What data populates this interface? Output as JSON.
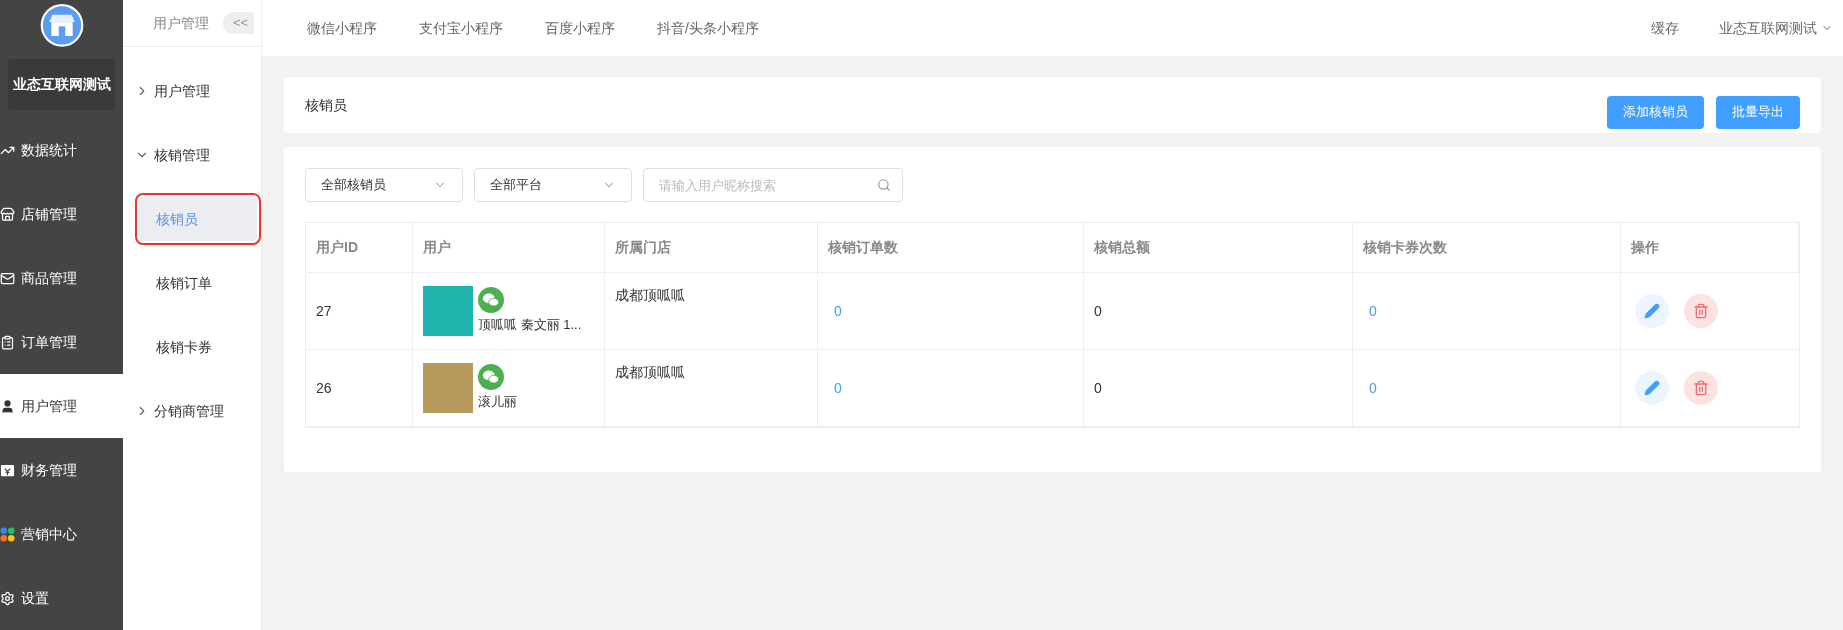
{
  "brand": {
    "name": "业态互联网测试"
  },
  "main_menu": [
    {
      "label": "数据统计",
      "selected": false
    },
    {
      "label": "店铺管理",
      "selected": false
    },
    {
      "label": "商品管理",
      "selected": false
    },
    {
      "label": "订单管理",
      "selected": false
    },
    {
      "label": "用户管理",
      "selected": true
    },
    {
      "label": "财务管理",
      "selected": false
    },
    {
      "label": "营销中心",
      "selected": false
    },
    {
      "label": "设置",
      "selected": false
    }
  ],
  "sub_menu": {
    "title": "用户管理",
    "collapse_button": "<<",
    "groups": [
      {
        "label": "用户管理",
        "expanded": false
      },
      {
        "label": "核销管理",
        "expanded": true,
        "children": [
          {
            "label": "核销员",
            "selected": true
          },
          {
            "label": "核销订单",
            "selected": false
          },
          {
            "label": "核销卡券",
            "selected": false
          }
        ]
      },
      {
        "label": "分销商管理",
        "expanded": false
      }
    ]
  },
  "top_tabs": [
    "微信小程序",
    "支付宝小程序",
    "百度小程序",
    "抖音/头条小程序"
  ],
  "top_right": {
    "cache": "缓存",
    "account": "业态互联网测试"
  },
  "header": {
    "title": "核销员",
    "buttons": [
      "添加核销员",
      "批量导出"
    ]
  },
  "filters": {
    "selects": [
      "全部核销员",
      "全部平台"
    ],
    "search": {
      "placeholder": "请输入用户昵称搜索"
    }
  },
  "table": {
    "columns": [
      "用户ID",
      "用户",
      "所属门店",
      "核销订单数",
      "核销总额",
      "核销卡券次数",
      "操作"
    ],
    "rows": [
      {
        "id": "27",
        "user": "顶呱呱 秦文丽 1...",
        "store": "成都顶呱呱",
        "orders": "0",
        "total": "0",
        "coupons": "0"
      },
      {
        "id": "26",
        "user": "滚儿丽",
        "store": "成都顶呱呱",
        "orders": "0",
        "total": "0",
        "coupons": "0"
      }
    ]
  }
}
